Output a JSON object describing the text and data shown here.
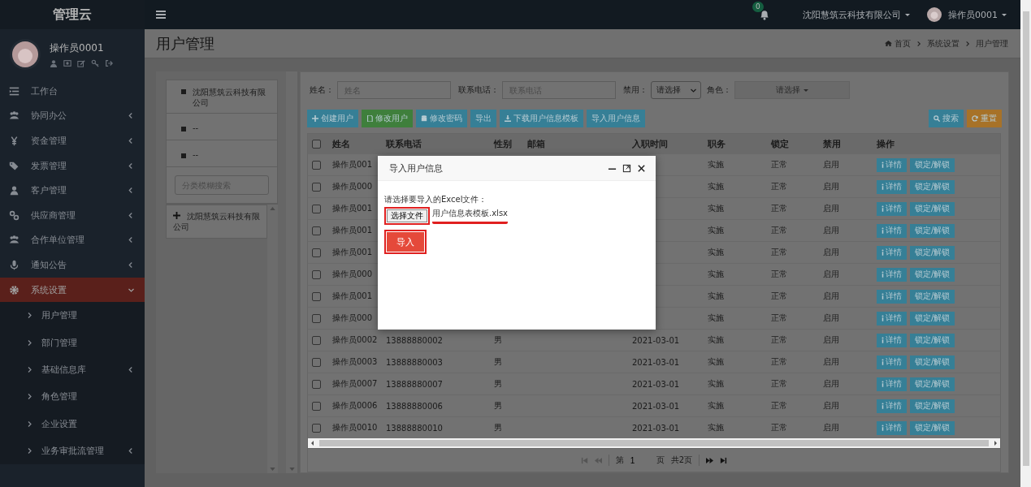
{
  "app": {
    "title": "管理云"
  },
  "profile": {
    "name": "操作员0001"
  },
  "sidebar": {
    "items": [
      {
        "label": "工作台",
        "selected": false,
        "expandable": false
      },
      {
        "label": "协同办公",
        "selected": false,
        "expandable": true,
        "expanded": false
      },
      {
        "label": "资金管理",
        "selected": false,
        "expandable": true,
        "expanded": false
      },
      {
        "label": "发票管理",
        "selected": false,
        "expandable": true,
        "expanded": false
      },
      {
        "label": "客户管理",
        "selected": false,
        "expandable": true,
        "expanded": false
      },
      {
        "label": "供应商管理",
        "selected": false,
        "expandable": true,
        "expanded": false
      },
      {
        "label": "合作单位管理",
        "selected": false,
        "expandable": true,
        "expanded": false
      },
      {
        "label": "通知公告",
        "selected": false,
        "expandable": true,
        "expanded": false
      },
      {
        "label": "系统设置",
        "selected": true,
        "expandable": true,
        "expanded": true,
        "children": [
          {
            "label": "用户管理",
            "expandable": false
          },
          {
            "label": "部门管理",
            "expandable": false
          },
          {
            "label": "基础信息库",
            "expandable": true
          },
          {
            "label": "角色管理",
            "expandable": false
          },
          {
            "label": "企业设置",
            "expandable": false
          },
          {
            "label": "业务审批流管理",
            "expandable": true
          }
        ]
      }
    ]
  },
  "topbar": {
    "notification_count": "0",
    "company": "沈阳慧筑云科技有限公司",
    "user": "操作员0001"
  },
  "page": {
    "title": "用户管理",
    "breadcrumb": [
      "首页",
      "系统设置",
      "用户管理"
    ]
  },
  "org_panel": {
    "items": [
      "沈阳慧筑云科技有限公司",
      "--",
      "--"
    ],
    "search_placeholder": "分类模糊搜索",
    "tree": [
      {
        "label": "沈阳慧筑云科技有限公司",
        "expanded": false
      }
    ]
  },
  "filters": [
    {
      "kind": "input",
      "label": "姓名：",
      "placeholder": "姓名"
    },
    {
      "kind": "input",
      "label": "联系电话：",
      "placeholder": "联系电话"
    },
    {
      "kind": "select",
      "label": "禁用：",
      "value": "请选择"
    },
    {
      "kind": "dropdown",
      "label": "角色：",
      "value": "请选择"
    }
  ],
  "toolbar": [
    {
      "label": "创建用户",
      "color": "#367f96"
    },
    {
      "label": "修改用户",
      "color": "#3f7f3c"
    },
    {
      "label": "修改密码",
      "color": "#367f96"
    },
    {
      "label": "导出",
      "color": "#367f96"
    },
    {
      "label": "下载用户信息模板",
      "color": "#367f96"
    },
    {
      "label": "导入用户信息",
      "color": "#367f96"
    }
  ],
  "search_buttons": [
    {
      "label": "搜索",
      "color": "#367f96"
    },
    {
      "label": "重置",
      "color": "#a77228"
    }
  ],
  "table": {
    "select_all": false,
    "columns": [
      "姓名",
      "联系电话",
      "性别",
      "邮箱",
      "入职时间",
      "职务",
      "锁定",
      "禁用",
      "操作"
    ],
    "rows": [
      {
        "checked": false,
        "name": "操作员001",
        "position": "实施",
        "locked": "正常",
        "status": "启用",
        "actions": [
          "详情",
          "锁定/解锁"
        ]
      },
      {
        "checked": false,
        "name": "操作员000",
        "position": "实施",
        "locked": "正常",
        "status": "启用",
        "actions": [
          "详情",
          "锁定/解锁"
        ]
      },
      {
        "checked": false,
        "name": "操作员001",
        "position": "实施",
        "locked": "正常",
        "status": "启用",
        "actions": [
          "详情",
          "锁定/解锁"
        ]
      },
      {
        "checked": false,
        "name": "操作员001",
        "position": "实施",
        "locked": "正常",
        "status": "启用",
        "actions": [
          "详情",
          "锁定/解锁"
        ]
      },
      {
        "checked": false,
        "name": "操作员001",
        "position": "实施",
        "locked": "正常",
        "status": "启用",
        "actions": [
          "详情",
          "锁定/解锁"
        ]
      },
      {
        "checked": false,
        "name": "操作员000",
        "position": "实施",
        "locked": "正常",
        "status": "启用",
        "actions": [
          "详情",
          "锁定/解锁"
        ]
      },
      {
        "checked": false,
        "name": "操作员001",
        "position": "实施",
        "locked": "正常",
        "status": "启用",
        "actions": [
          "详情",
          "锁定/解锁"
        ]
      },
      {
        "checked": false,
        "name": "操作员000",
        "position": "实施",
        "locked": "正常",
        "status": "启用",
        "actions": [
          "详情",
          "锁定/解锁"
        ]
      },
      {
        "checked": false,
        "name": "操作员0002",
        "phone": "13888880002",
        "gender": "男",
        "date": "2021-03-01",
        "position": "实施",
        "locked": "正常",
        "status": "启用",
        "actions": [
          "详情",
          "锁定/解锁"
        ]
      },
      {
        "checked": false,
        "name": "操作员0003",
        "phone": "13888880003",
        "gender": "男",
        "date": "2021-03-01",
        "position": "实施",
        "locked": "正常",
        "status": "启用",
        "actions": [
          "详情",
          "锁定/解锁"
        ]
      },
      {
        "checked": false,
        "name": "操作员0007",
        "phone": "13888880007",
        "gender": "男",
        "date": "2021-03-01",
        "position": "实施",
        "locked": "正常",
        "status": "启用",
        "actions": [
          "详情",
          "锁定/解锁"
        ]
      },
      {
        "checked": false,
        "name": "操作员0006",
        "phone": "13888880006",
        "gender": "男",
        "date": "2021-03-01",
        "position": "实施",
        "locked": "正常",
        "status": "启用",
        "actions": [
          "详情",
          "锁定/解锁"
        ]
      },
      {
        "checked": false,
        "name": "操作员0010",
        "phone": "13888880010",
        "gender": "男",
        "date": "2021-03-01",
        "position": "实施",
        "locked": "正常",
        "status": "启用",
        "actions": [
          "详情",
          "锁定/解锁"
        ]
      }
    ]
  },
  "pager": {
    "prefix": "第",
    "page": "1",
    "suffix": "页",
    "total": "共2页",
    "first_disabled": true,
    "prev_disabled": true,
    "next_disabled": false,
    "last_disabled": false
  },
  "modal": {
    "title": "导入用户信息",
    "prompt": "请选择要导入的Excel文件：",
    "file_button": {
      "label": "选择文件",
      "highlighted": true
    },
    "file_name": {
      "text": "用户信息表模板.xlsx",
      "underlined": true
    },
    "import_button": {
      "label": "导入",
      "highlighted": true
    }
  }
}
